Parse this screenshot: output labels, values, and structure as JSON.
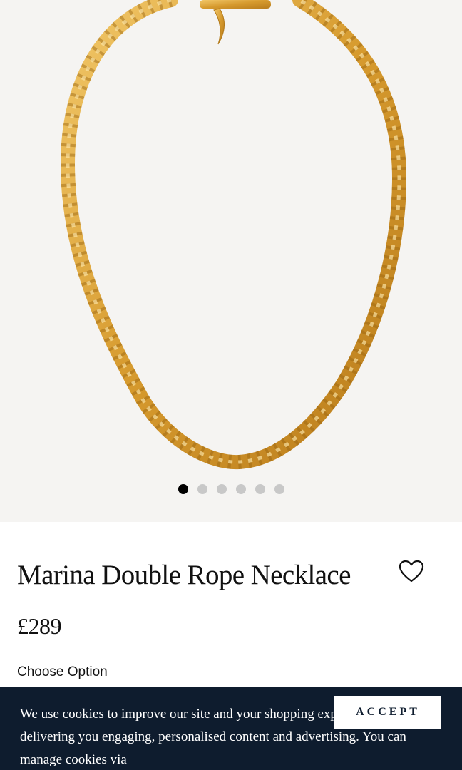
{
  "product": {
    "title": "Marina Double Rope Necklace",
    "price": "£289",
    "choose_option_label": "Choose Option"
  },
  "gallery": {
    "slide_count": 6,
    "active_slide": 1,
    "image_subject": "necklace-image"
  },
  "icons": {
    "wishlist": "heart-icon"
  },
  "cookie_banner": {
    "text": "We use cookies to improve our site and your shopping experience by delivering you engaging, personalised content and advertising. You can manage cookies via",
    "accept_label": "ACCEPT"
  },
  "colors": {
    "banner_bg": "#0e1c2e",
    "gold": "#d9a33a",
    "dot_active": "#000000",
    "dot_inactive": "#c8c8c8"
  }
}
